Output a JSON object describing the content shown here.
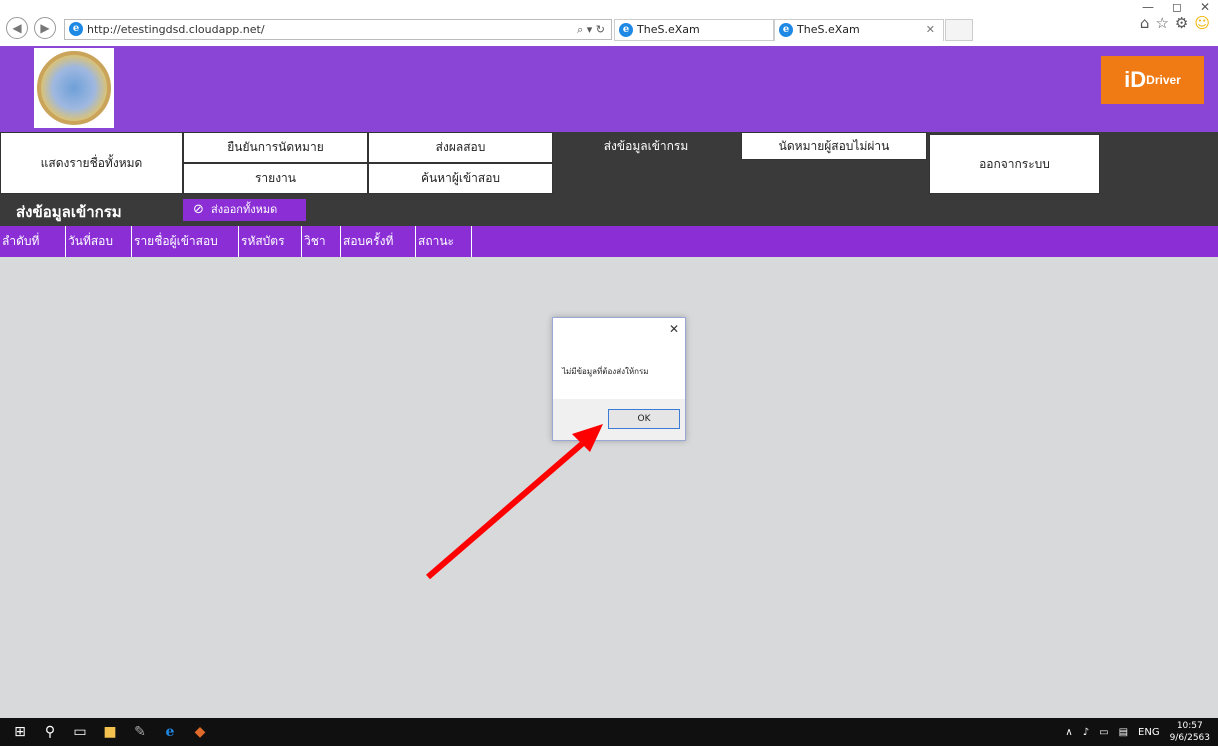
{
  "browser": {
    "url": "http://etestingdsd.cloudapp.net/",
    "tabs": [
      {
        "title": "TheS.eXam"
      },
      {
        "title": "TheS.eXam"
      }
    ],
    "search_tools": "⌕ ▾ ↻",
    "window_controls": [
      "—",
      "◻",
      "✕"
    ],
    "right_icons": [
      "⌂",
      "☆",
      "⚙",
      "☺"
    ]
  },
  "banner": {
    "brand_big": "iD",
    "brand_small": "Driver",
    "accent": "#8b45d6",
    "brand_color": "#f07b14"
  },
  "menu": {
    "show_all": "แสดงรายชื่อทั้งหมด",
    "confirm_appointment": "ยืนยันการนัดหมาย",
    "send_results": "ส่งผลสอบ",
    "send_to_dept": "ส่งข้อมูลเข้ากรม",
    "appoint_failed": "นัดหมายผู้สอบไม่ผ่าน",
    "logout": "ออกจากระบบ",
    "report": "รายงาน",
    "search_examinee": "ค้นหาผู้เข้าสอบ"
  },
  "page": {
    "title": "ส่งข้อมูลเข้ากรม",
    "export_all": "ส่งออกทั้งหมด"
  },
  "table": {
    "columns": [
      "ลำดับที่",
      "วันที่สอบ",
      "รายชื่อผู้เข้าสอบ",
      "รหัสบัตร",
      "วิชา",
      "สอบครั้งที่",
      "สถานะ"
    ]
  },
  "dialog": {
    "message": "ไม่มีข้อมูลที่ต้องส่งให้กรม",
    "ok": "OK",
    "close": "✕"
  },
  "taskbar": {
    "time": "10:57",
    "date": "9/6/2563",
    "lang": "ENG"
  }
}
